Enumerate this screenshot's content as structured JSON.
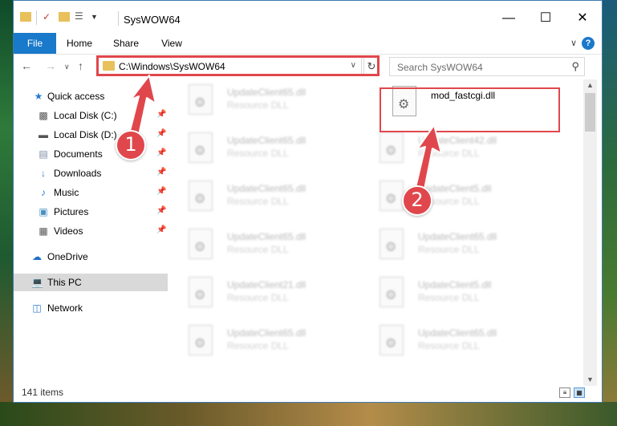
{
  "window": {
    "title": "SysWOW64",
    "minimize": "—",
    "maximize": "☐",
    "close": "✕"
  },
  "ribbon": {
    "tabs": [
      "File",
      "Home",
      "Share",
      "View"
    ],
    "expand_icon": "chevron-down-icon",
    "help_icon": "help-icon"
  },
  "address": {
    "path": "C:\\Windows\\SysWOW64",
    "search_placeholder": "Search SysWOW64"
  },
  "navpane": {
    "items": [
      {
        "label": "Quick access",
        "icon": "star-icon",
        "pinned": false
      },
      {
        "label": "Local Disk (C:)",
        "icon": "drive-icon",
        "pinned": true
      },
      {
        "label": "Local Disk (D:)",
        "icon": "drive-icon",
        "pinned": true
      },
      {
        "label": "Documents",
        "icon": "documents-icon",
        "pinned": true
      },
      {
        "label": "Downloads",
        "icon": "download-icon",
        "pinned": true
      },
      {
        "label": "Music",
        "icon": "music-icon",
        "pinned": true
      },
      {
        "label": "Pictures",
        "icon": "pictures-icon",
        "pinned": true
      },
      {
        "label": "Videos",
        "icon": "videos-icon",
        "pinned": true
      },
      {
        "label": "OneDrive",
        "icon": "cloud-icon",
        "pinned": false
      },
      {
        "label": "This PC",
        "icon": "computer-icon",
        "pinned": false,
        "selected": true
      },
      {
        "label": "Network",
        "icon": "network-icon",
        "pinned": false
      }
    ]
  },
  "files": {
    "left_column": [
      {
        "name": "UpdateClient65.dll",
        "type": "Resource DLL"
      },
      {
        "name": "UpdateClient65.dll",
        "type": "Resource DLL"
      },
      {
        "name": "UpdateClient65.dll",
        "type": "Resource DLL"
      },
      {
        "name": "UpdateClient65.dll",
        "type": "Resource DLL"
      },
      {
        "name": "UpdateClient21.dll",
        "type": "Resource DLL"
      },
      {
        "name": "UpdateClient65.dll",
        "type": "Resource DLL"
      }
    ],
    "right_column": [
      {
        "name": "mod_fastcgi.dll",
        "type": "",
        "highlighted": true
      },
      {
        "name": "UpdateClient42.dll",
        "type": "Resource DLL"
      },
      {
        "name": "UpdateClient5.dll",
        "type": "Resource DLL"
      },
      {
        "name": "UpdateClient65.dll",
        "type": "Resource DLL"
      },
      {
        "name": "UpdateClient5.dll",
        "type": "Resource DLL"
      },
      {
        "name": "UpdateClient65.dll",
        "type": "Resource DLL"
      }
    ]
  },
  "status": {
    "item_count": "141 items"
  },
  "callouts": {
    "step1": "1",
    "step2": "2",
    "color": "#e0474c"
  },
  "colors": {
    "accent": "#1979ca",
    "highlight": "#e0474c",
    "selected_bg": "#d9d9d9"
  }
}
